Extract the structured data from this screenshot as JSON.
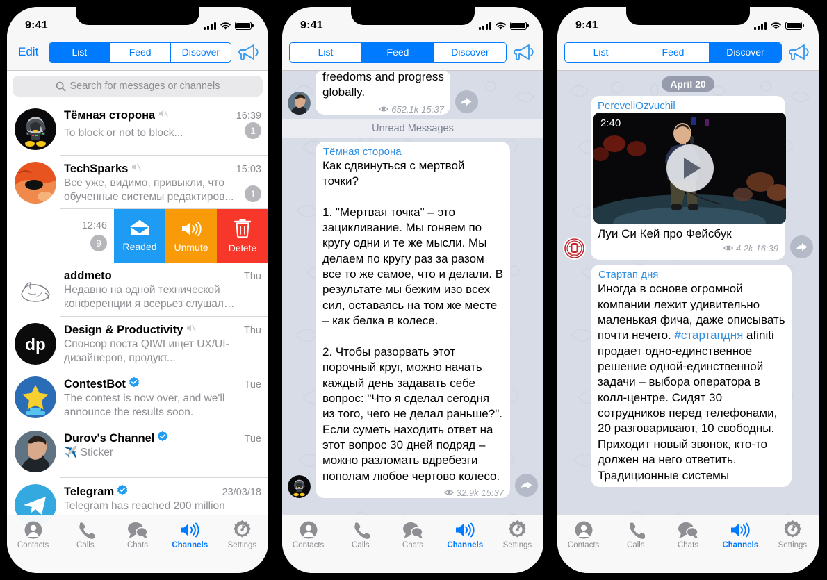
{
  "status": {
    "time": "9:41"
  },
  "nav": {
    "edit_label": "Edit",
    "megaphone_icon": "megaphone-icon",
    "segments": [
      {
        "label": "List"
      },
      {
        "label": "Feed"
      },
      {
        "label": "Discover"
      }
    ]
  },
  "search": {
    "placeholder": "Search for messages or channels",
    "icon": "search-icon"
  },
  "tabbar": {
    "items": [
      {
        "label": "Contacts",
        "icon": "contact-icon",
        "active": false
      },
      {
        "label": "Calls",
        "icon": "phone-icon",
        "active": false
      },
      {
        "label": "Chats",
        "icon": "chat-bubble-icon",
        "active": false
      },
      {
        "label": "Channels",
        "icon": "speaker-icon",
        "active": true
      },
      {
        "label": "Settings",
        "icon": "gear-icon",
        "active": false
      }
    ]
  },
  "phone1": {
    "active_segment": "List",
    "chats": [
      {
        "name": "Тёмная сторона",
        "muted": true,
        "verified": false,
        "time": "16:39",
        "message": "To block or not to block...",
        "badge": "1",
        "avatar": "darth-penguin-avatar"
      },
      {
        "name": "TechSparks",
        "muted": true,
        "verified": false,
        "time": "15:03",
        "message": "Все уже, видимо, привыкли, что обученные системы редактиров...",
        "badge": "1",
        "avatar": "orange-mask-avatar"
      }
    ],
    "swipe_row": {
      "time": "12:46",
      "badge": "9",
      "actions": [
        {
          "label": "Readed",
          "icon": "envelope-open-icon",
          "color": "#1e9cf4"
        },
        {
          "label": "Unmute",
          "icon": "speaker-icon",
          "color": "#f99a08"
        },
        {
          "label": "Delete",
          "icon": "trash-icon",
          "color": "#f8372b"
        }
      ]
    },
    "chats_after": [
      {
        "name": "addmeto",
        "muted": false,
        "verified": false,
        "time": "Thu",
        "message": "Недавно на одной технической конференции я всерьез слушал истор...",
        "badge": "",
        "avatar": "sleeping-cat-avatar"
      },
      {
        "name": "Design & Productivity",
        "muted": true,
        "verified": false,
        "time": "Thu",
        "message": "Спонсор поста\nQIWI ищет UX/UI-дизайнеров, продукт...",
        "badge": "",
        "avatar": "dp-avatar"
      },
      {
        "name": "ContestBot",
        "muted": false,
        "verified": true,
        "time": "Tue",
        "message": "The contest is now over, and we'll announce the results soon.",
        "badge": "",
        "avatar": "star-avatar"
      },
      {
        "name": "Durov's Channel",
        "muted": false,
        "verified": true,
        "time": "Tue",
        "message": "✈️ Sticker",
        "badge": "",
        "avatar": "durov-avatar"
      },
      {
        "name": "Telegram",
        "muted": false,
        "verified": true,
        "time": "23/03/18",
        "message": "Telegram has reached 200 million",
        "badge": "",
        "avatar": "telegram-avatar"
      }
    ]
  },
  "phone2": {
    "active_segment": "Feed",
    "top_post": {
      "text_tail": "freedoms and progress\nglobally.",
      "views": "652.1k",
      "time": "15:37",
      "avatar": "durov-avatar"
    },
    "unread_separator": "Unread Messages",
    "post": {
      "author": "Тёмная сторона",
      "avatar": "darth-penguin-avatar",
      "text": "Как сдвинуться с мертвой точки?\n\n1. \"Мертвая точка\" – это зацикливание. Мы гоняем по кругу одни и те же мысли. Мы делаем по кругу раз за разом все то же самое, что и делали. В результате мы бежим изо всех сил, оставаясь на том же месте – как белка в колесе.\n\n2. Чтобы разорвать этот порочный круг, можно начать каждый день задавать себе вопрос: \"Что я сделал сегодня из того, чего не делал раньше?\". Если суметь находить ответ на этот вопрос 30 дней подряд – можно разломать вдребезги пополам любое чертово колесо.",
      "views": "32.9k",
      "time": "15:37"
    }
  },
  "phone3": {
    "active_segment": "Discover",
    "day_chip": "April 20",
    "video_post": {
      "author": "PereveliOzvuchil",
      "duration": "2:40",
      "caption": "Луи Си Кей про Фейсбук",
      "views": "4.2k",
      "time": "16:39",
      "avatar": "red-emblem-avatar",
      "play_icon": "play-icon",
      "share_icon": "share-arrow-icon"
    },
    "text_post": {
      "author": "Стартап дня",
      "text_before": "Иногда в основе огромной компании лежит удивительно маленькая фича, даже описывать почти нечего. ",
      "hashtag": "#стартапдня",
      "text_after": " afiniti продает одно-единственное решение одной-единственной задачи – выбора оператора в колл-центре. Сидят 30 сотрудников перед телефонами, 20 разговаривают, 10 свободны. Приходит новый звонок, кто-то должен на него ответить. Традиционные системы"
    }
  },
  "colors": {
    "accent": "#007aff",
    "feed_bg": "#d8dce6",
    "muted_text": "#8e8e93",
    "author_blue": "#2f8fe0",
    "read_action": "#1e9cf4",
    "unmute_action": "#f99a08",
    "delete_action": "#f8372b"
  }
}
